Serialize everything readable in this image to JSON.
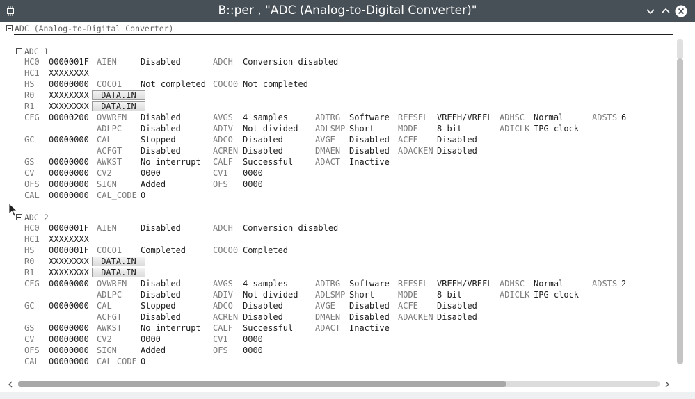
{
  "window": {
    "title": "B::per , \"ADC (Analog-to-Digital Converter)\""
  },
  "root_label": "ADC (Analog-to-Digital Converter)",
  "colors": {
    "titlebar": "#475057",
    "label": "#7b7b7b",
    "value": "#202020",
    "button": "#dcdcdc"
  },
  "icons": [
    "chip-icon",
    "chevron-down-icon",
    "chevron-up-icon",
    "close-icon",
    "chevron-left-icon",
    "chevron-right-icon",
    "mouse-cursor-icon"
  ],
  "sections": [
    {
      "name": "ADC_1",
      "rows": [
        {
          "reg": "HC0",
          "val": "0000001F",
          "fields": [
            [
              "AIEN",
              "Disabled"
            ],
            [
              "ADCH",
              "Conversion disabled"
            ]
          ]
        },
        {
          "reg": "HC1",
          "val": "XXXXXXXX",
          "fields": []
        },
        {
          "reg": "HS",
          "val": "00000000",
          "fields": [
            [
              "COCO1",
              "Not completed"
            ],
            [
              "COCO0",
              "Not completed"
            ]
          ]
        },
        {
          "reg": "R0",
          "val": "XXXXXXXX",
          "button": "DATA.IN",
          "fields": []
        },
        {
          "reg": "R1",
          "val": "XXXXXXXX",
          "button": "DATA.IN",
          "fields": []
        },
        {
          "reg": "CFG",
          "val": "00000200",
          "fields": [
            [
              "OVWREN",
              "Disabled"
            ],
            [
              "AVGS",
              "4 samples"
            ],
            [
              "ADTRG",
              "Software"
            ],
            [
              "REFSEL",
              "VREFH/VREFL"
            ],
            [
              "ADHSC",
              "Normal"
            ],
            [
              "ADSTS",
              "6"
            ]
          ]
        },
        {
          "reg": "",
          "val": "",
          "fields": [
            [
              "ADLPC",
              "Disabled"
            ],
            [
              "ADIV",
              "Not divided"
            ],
            [
              "ADLSMP",
              "Short"
            ],
            [
              "MODE",
              "8-bit"
            ],
            [
              "ADICLK",
              "IPG clock"
            ]
          ]
        },
        {
          "reg": "GC",
          "val": "00000000",
          "fields": [
            [
              "CAL",
              "Stopped"
            ],
            [
              "ADCO",
              "Disabled"
            ],
            [
              "AVGE",
              "Disabled"
            ],
            [
              "ACFE",
              "Disabled"
            ]
          ]
        },
        {
          "reg": "",
          "val": "",
          "fields": [
            [
              "ACFGT",
              "Disabled"
            ],
            [
              "ACREN",
              "Disabled"
            ],
            [
              "DMAEN",
              "Disabled"
            ],
            [
              "ADACKEN",
              "Disabled"
            ]
          ]
        },
        {
          "reg": "GS",
          "val": "00000000",
          "fields": [
            [
              "AWKST",
              "No interrupt"
            ],
            [
              "CALF",
              "Successful"
            ],
            [
              "ADACT",
              "Inactive"
            ]
          ]
        },
        {
          "reg": "CV",
          "val": "00000000",
          "fields": [
            [
              "CV2",
              "0000"
            ],
            [
              "CV1",
              "0000"
            ]
          ]
        },
        {
          "reg": "OFS",
          "val": "00000000",
          "fields": [
            [
              "SIGN",
              "Added"
            ],
            [
              "OFS",
              "0000"
            ]
          ]
        },
        {
          "reg": "CAL",
          "val": "00000000",
          "fields": [
            [
              "CAL_CODE",
              "0"
            ]
          ]
        }
      ]
    },
    {
      "name": "ADC_2",
      "rows": [
        {
          "reg": "HC0",
          "val": "0000001F",
          "fields": [
            [
              "AIEN",
              "Disabled"
            ],
            [
              "ADCH",
              "Conversion disabled"
            ]
          ]
        },
        {
          "reg": "HC1",
          "val": "XXXXXXXX",
          "fields": []
        },
        {
          "reg": "HS",
          "val": "0000001F",
          "fields": [
            [
              "COCO1",
              "Completed"
            ],
            [
              "COCO0",
              "Completed"
            ]
          ]
        },
        {
          "reg": "R0",
          "val": "XXXXXXXX",
          "button": "DATA.IN",
          "fields": []
        },
        {
          "reg": "R1",
          "val": "XXXXXXXX",
          "button": "DATA.IN",
          "fields": []
        },
        {
          "reg": "CFG",
          "val": "00000000",
          "fields": [
            [
              "OVWREN",
              "Disabled"
            ],
            [
              "AVGS",
              "4 samples"
            ],
            [
              "ADTRG",
              "Software"
            ],
            [
              "REFSEL",
              "VREFH/VREFL"
            ],
            [
              "ADHSC",
              "Normal"
            ],
            [
              "ADSTS",
              "2"
            ]
          ]
        },
        {
          "reg": "",
          "val": "",
          "fields": [
            [
              "ADLPC",
              "Disabled"
            ],
            [
              "ADIV",
              "Not divided"
            ],
            [
              "ADLSMP",
              "Short"
            ],
            [
              "MODE",
              "8-bit"
            ],
            [
              "ADICLK",
              "IPG clock"
            ]
          ]
        },
        {
          "reg": "GC",
          "val": "00000000",
          "fields": [
            [
              "CAL",
              "Stopped"
            ],
            [
              "ADCO",
              "Disabled"
            ],
            [
              "AVGE",
              "Disabled"
            ],
            [
              "ACFE",
              "Disabled"
            ]
          ]
        },
        {
          "reg": "",
          "val": "",
          "fields": [
            [
              "ACFGT",
              "Disabled"
            ],
            [
              "ACREN",
              "Disabled"
            ],
            [
              "DMAEN",
              "Disabled"
            ],
            [
              "ADACKEN",
              "Disabled"
            ]
          ]
        },
        {
          "reg": "GS",
          "val": "00000000",
          "fields": [
            [
              "AWKST",
              "No interrupt"
            ],
            [
              "CALF",
              "Successful"
            ],
            [
              "ADACT",
              "Inactive"
            ]
          ]
        },
        {
          "reg": "CV",
          "val": "00000000",
          "fields": [
            [
              "CV2",
              "0000"
            ],
            [
              "CV1",
              "0000"
            ]
          ]
        },
        {
          "reg": "OFS",
          "val": "00000000",
          "fields": [
            [
              "SIGN",
              "Added"
            ],
            [
              "OFS",
              "0000"
            ]
          ]
        },
        {
          "reg": "CAL",
          "val": "00000000",
          "fields": [
            [
              "CAL_CODE",
              "0"
            ]
          ]
        }
      ]
    }
  ]
}
